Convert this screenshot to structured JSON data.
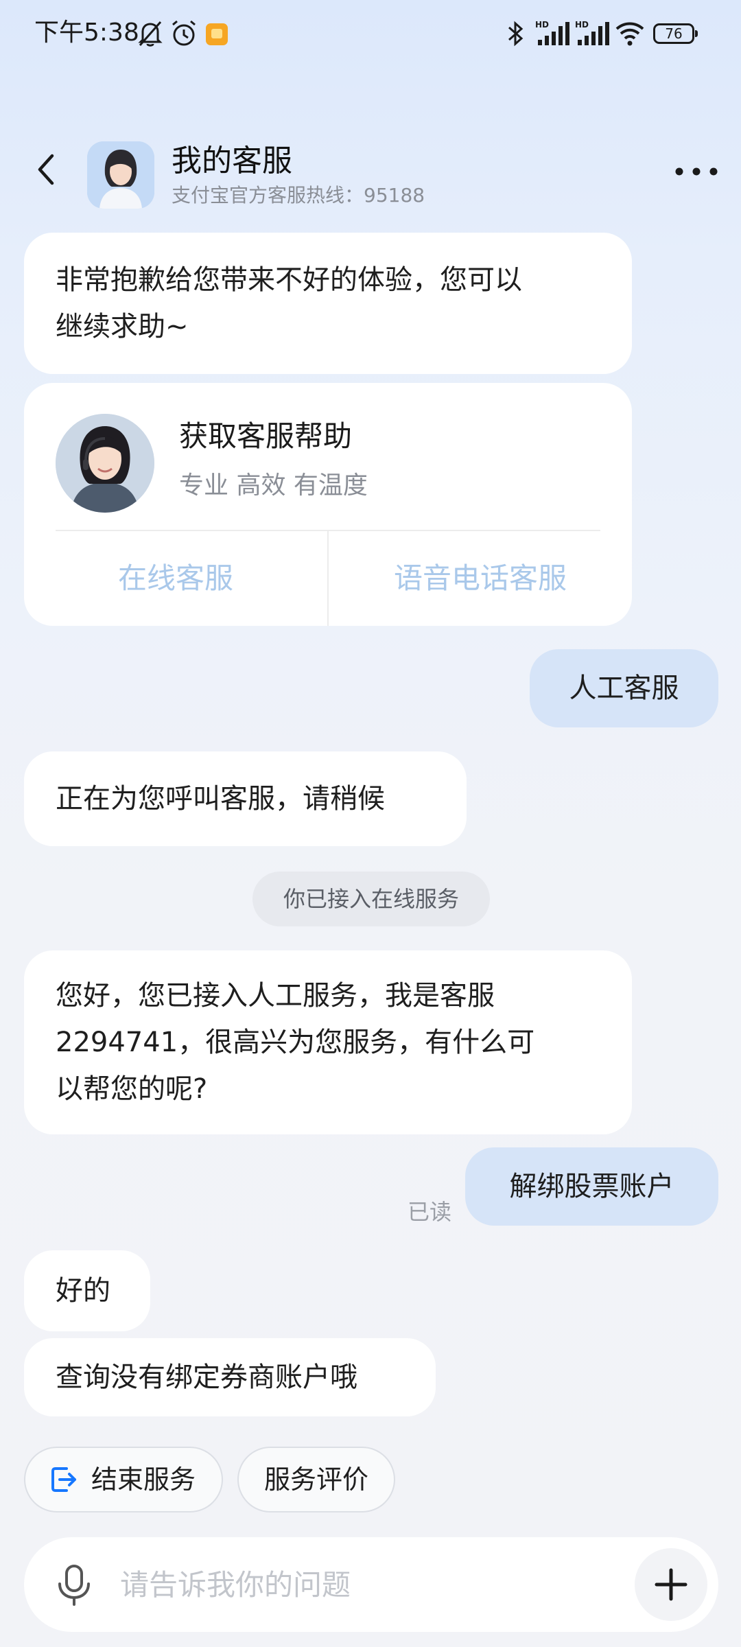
{
  "status_bar": {
    "time": "下午5:38",
    "battery": "76"
  },
  "header": {
    "title": "我的客服",
    "subtitle": "支付宝官方客服热线：95188"
  },
  "messages": {
    "m1": [
      "非常抱歉给您带来不好的体验，您可以",
      "继续求助~"
    ],
    "help_card": {
      "title": "获取客服帮助",
      "subtitle": "专业 高效 有温度",
      "online_button": "在线客服",
      "voice_button": "语音电话客服"
    },
    "user1": "人工客服",
    "m2": "正在为您呼叫客服，请稍候",
    "system_notice": "你已接入在线服务",
    "m3": [
      "您好，您已接入人工服务，我是客服",
      "2294741，很高兴为您服务，有什么可",
      "以帮您的呢?"
    ],
    "user2": "解绑股票账户",
    "read_receipt": "已读",
    "m4": "好的",
    "m5": "查询没有绑定券商账户哦"
  },
  "actions": {
    "end_service": "结束服务",
    "rate_service": "服务评价"
  },
  "input": {
    "placeholder": "请告诉我你的问题"
  },
  "colors": {
    "user_bubble": "#d6e4f8",
    "link_blue": "#a9c8ea",
    "accent_blue": "#1677ff"
  }
}
